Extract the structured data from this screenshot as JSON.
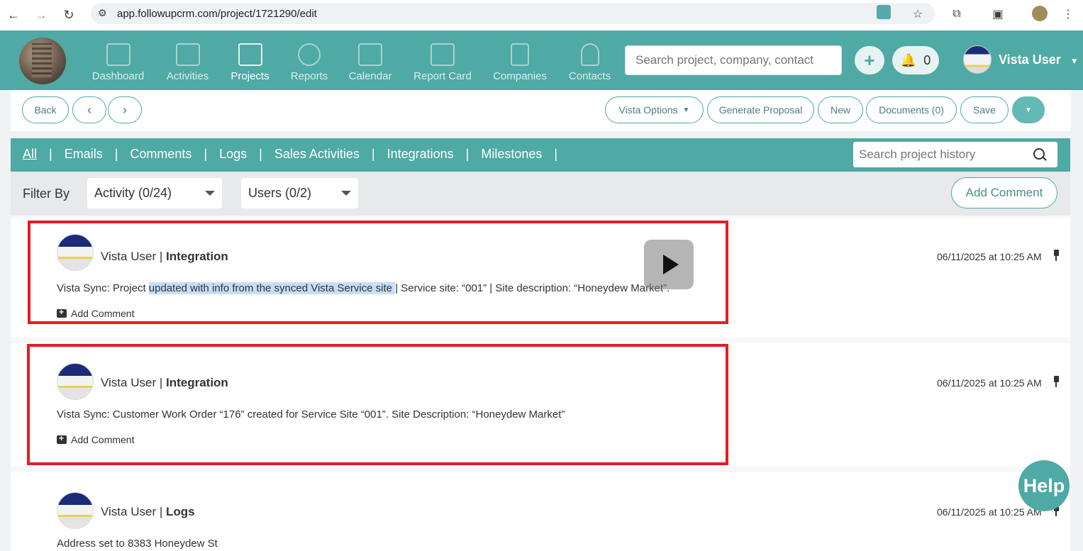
{
  "browser": {
    "url": "app.followupcrm.com/project/1721290/edit"
  },
  "nav": {
    "items": [
      {
        "label": "Dashboard",
        "icon": "bar-chart-icon"
      },
      {
        "label": "Activities",
        "icon": "checklist-icon"
      },
      {
        "label": "Projects",
        "icon": "folder-icon"
      },
      {
        "label": "Reports",
        "icon": "target-icon"
      },
      {
        "label": "Calendar",
        "icon": "calendar-icon"
      },
      {
        "label": "Report Card",
        "icon": "report-card-icon"
      },
      {
        "label": "Companies",
        "icon": "building-icon"
      },
      {
        "label": "Contacts",
        "icon": "person-icon"
      }
    ],
    "active": "Projects",
    "search_placeholder": "Search project, company, contact",
    "notifications_count": "0",
    "user_name": "Vista User"
  },
  "toolbar": {
    "back": "Back",
    "prev": "‹",
    "next": "›",
    "vista_options": "Vista Options",
    "generate_proposal": "Generate Proposal",
    "new": "New",
    "documents": "Documents (0)",
    "save": "Save"
  },
  "tabs": {
    "items": [
      "All",
      "Emails",
      "Comments",
      "Logs",
      "Sales Activities",
      "Integrations",
      "Milestones"
    ],
    "search_placeholder": "Search project history"
  },
  "filters": {
    "label": "Filter By",
    "activity": "Activity (0/24)",
    "users": "Users (0/2)",
    "add_comment": "Add Comment"
  },
  "entries": [
    {
      "user": "Vista User",
      "separator": " | ",
      "type": "Integration",
      "time": "06/11/2025 at 10:25 AM",
      "body_prefix": "Vista Sync: Project ",
      "body_highlight": "updated with info from the synced Vista Service site ",
      "body_suffix": "| Service site: “001” | Site description: “Honeydew Market”.",
      "add_comment": "Add Comment"
    },
    {
      "user": "Vista User",
      "separator": " | ",
      "type": "Integration",
      "time": "06/11/2025 at 10:25 AM",
      "body": "Vista Sync: Customer Work Order “176” created for Service Site “001”. Site Description: “Honeydew Market”",
      "add_comment": "Add Comment"
    },
    {
      "user": "Vista User",
      "separator": " | ",
      "type": "Logs",
      "time": "06/11/2025 at 10:25 AM",
      "body": "Address set to 8383 Honeydew St"
    }
  ],
  "help": "Help",
  "colors": {
    "brand": "#4fa9a5",
    "highlight_box": "#e21d26",
    "text_highlight": "#c7ddf6"
  }
}
